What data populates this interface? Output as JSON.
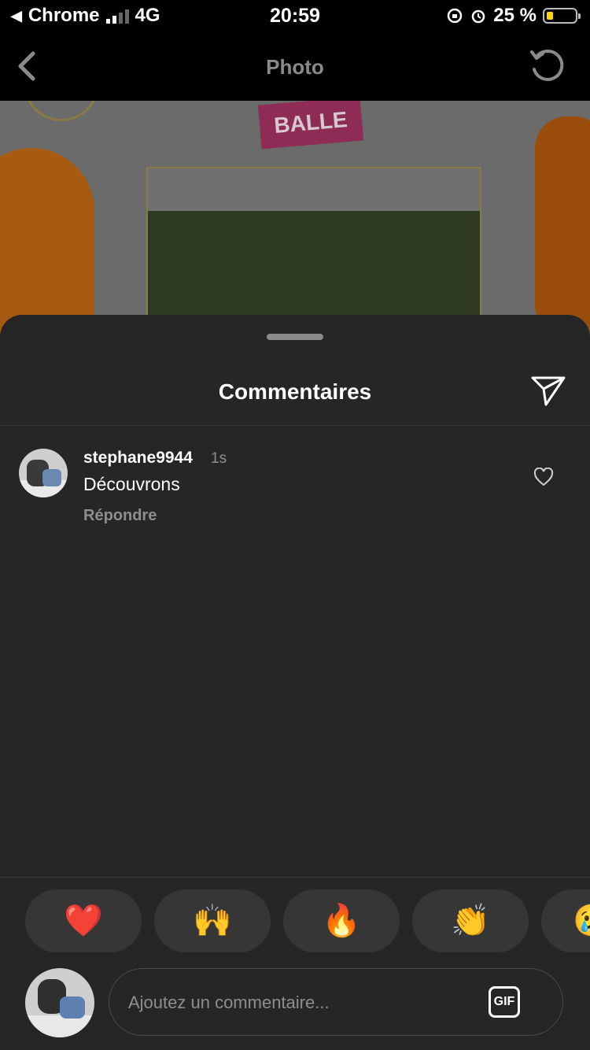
{
  "status_bar": {
    "app": "Chrome",
    "network": "4G",
    "time": "20:59",
    "battery": "25 %",
    "back_arrow": "◀"
  },
  "nav": {
    "title": "Photo"
  },
  "photo": {
    "badge_text": "BALLE"
  },
  "comments": {
    "title": "Commentaires",
    "items": [
      {
        "username": "stephane9944",
        "time": "1s",
        "text": "Découvrons",
        "reply": "Répondre"
      }
    ]
  },
  "reactions": [
    "❤️",
    "🙌",
    "🔥",
    "👏",
    "😢"
  ],
  "input": {
    "placeholder": "Ajoutez un commentaire...",
    "gif_label": "GIF"
  },
  "colors": {
    "sheet_bg": "#262626",
    "reaction_bg": "#363636",
    "muted_text": "#8e8e8e",
    "battery_fill": "#ffd60a"
  }
}
